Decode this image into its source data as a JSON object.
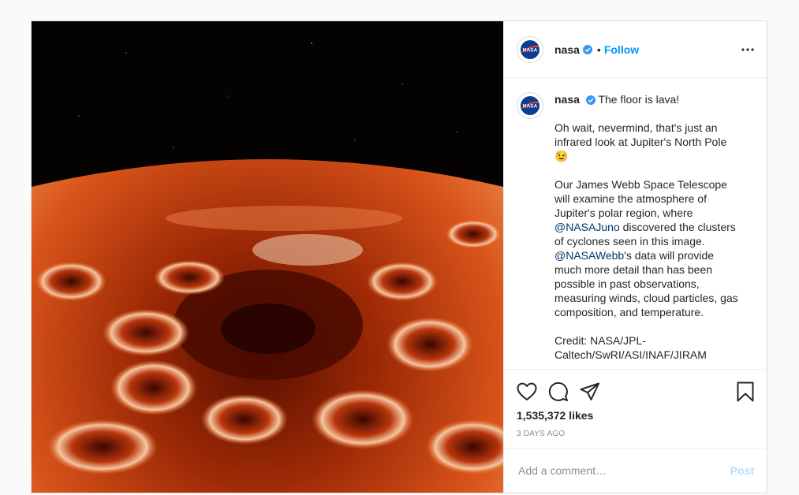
{
  "post": {
    "image_alt": "Infrared view of Jupiter's North Pole",
    "header": {
      "username": "nasa",
      "separator": "•",
      "follow_label": "Follow"
    },
    "caption": {
      "username": "nasa",
      "line1": "The floor is lava!",
      "para2": "Oh wait, nevermind, that's just an infrared look at Jupiter's North Pole",
      "emoji": "😉",
      "para3_a": "Our James Webb Space Telescope will examine the atmosphere of Jupiter's polar region, where ",
      "mention1": "@NASAJuno",
      "para3_b": " discovered the clusters of cyclones seen in this image. ",
      "mention2": "@NASAWebb",
      "para3_c": "'s data will provide much more detail than has been possible in past observations, measuring winds, cloud particles, gas composition, and temperature.",
      "credit": "Credit: NASA/JPL-Caltech/SwRI/ASI/INAF/JIRAM"
    },
    "likes": "1,535,372 likes",
    "timestamp": "3 DAYS AGO",
    "comment": {
      "placeholder": "Add a comment…",
      "post_label": "Post"
    }
  },
  "colors": {
    "follow": "#0095f6",
    "mention": "#00376b",
    "verified": "#3897f0",
    "post_disabled": "#b2dffc"
  },
  "icons": [
    "nasa-logo-icon",
    "verified-badge-icon",
    "more-options-icon",
    "heart-icon",
    "comment-icon",
    "share-icon",
    "bookmark-icon"
  ]
}
